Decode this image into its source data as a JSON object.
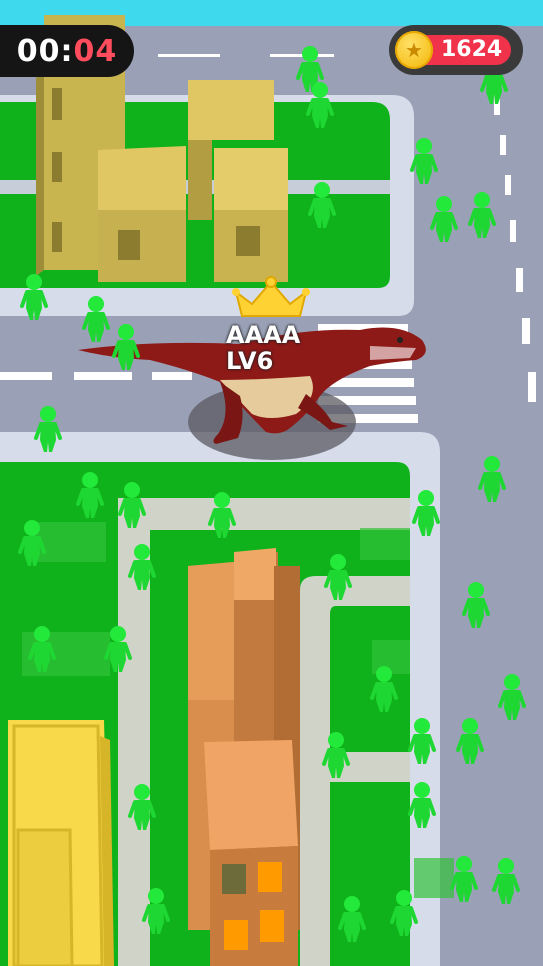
{
  "hud": {
    "timer_minutes": "00",
    "timer_separator": ":",
    "timer_seconds": "04",
    "coin_count": "1624",
    "coin_icon": "star-coin-icon"
  },
  "player": {
    "name": "AAAA",
    "level": "LV6",
    "crown_icon": "crown-icon"
  },
  "colors": {
    "grass": "#0fb21a",
    "road": "#9aa1b6",
    "sidewalk": "#d6dcea",
    "crowd": "#22e93a",
    "dino": "#8e1a18",
    "timer_seconds": "#ff4d5e",
    "coin_bar": "#f0324a"
  }
}
